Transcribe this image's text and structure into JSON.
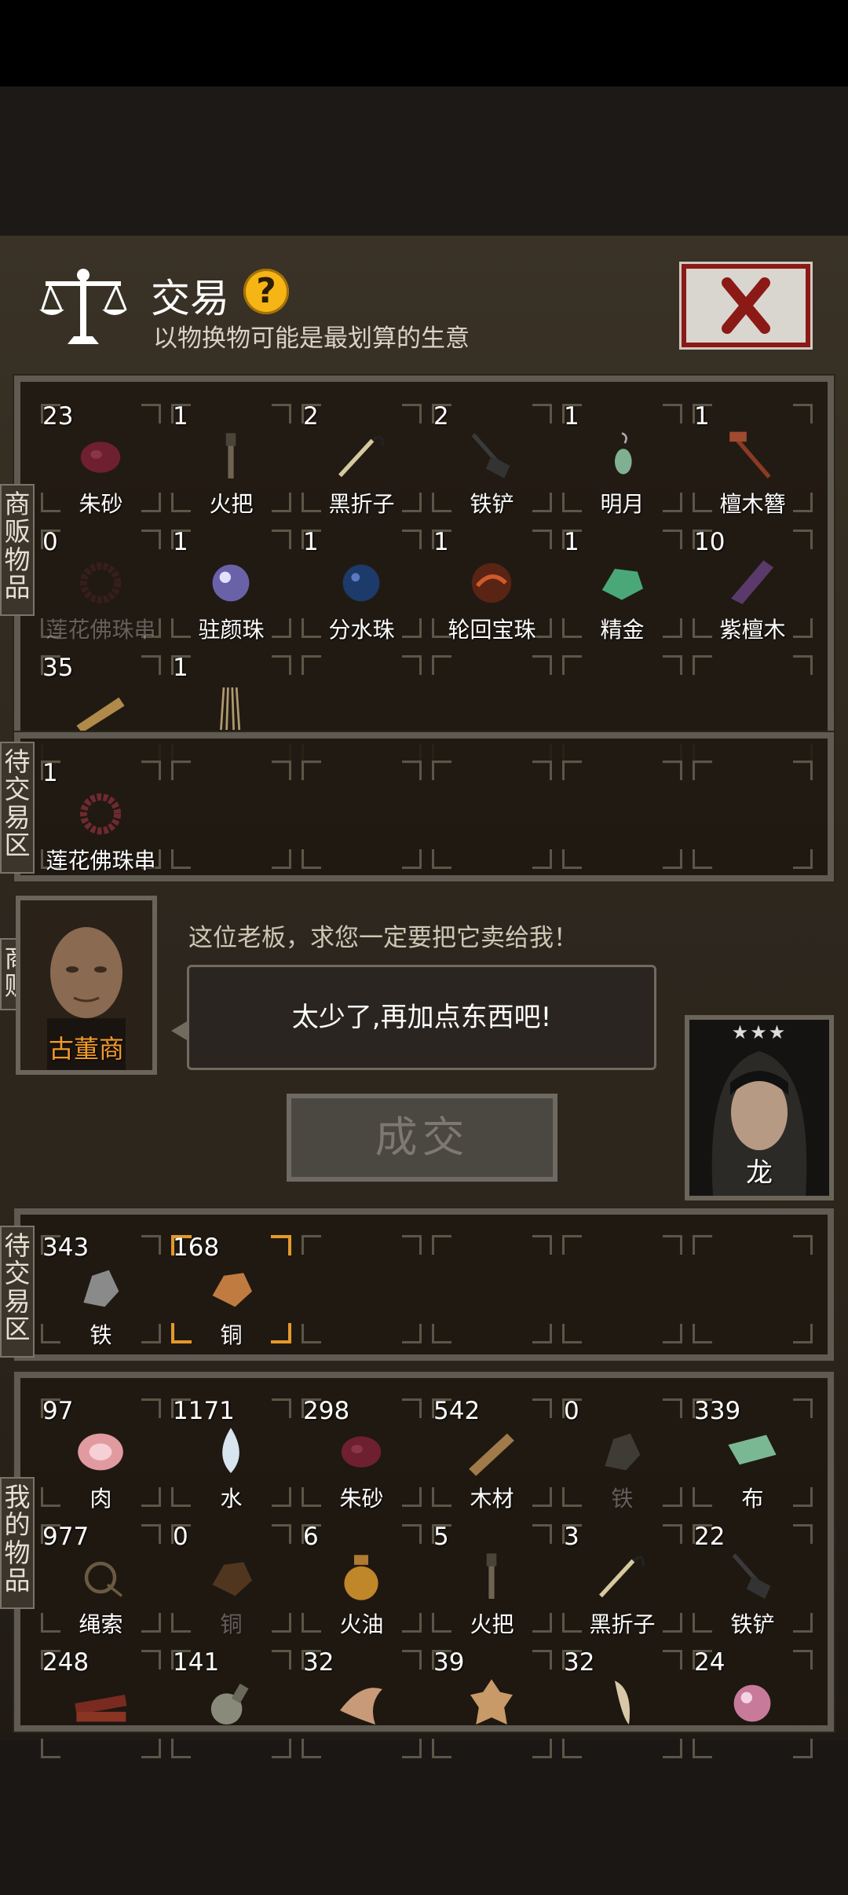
{
  "header": {
    "title": "交易",
    "help_icon": "?",
    "subtitle": "以物换物可能是最划算的生意"
  },
  "labels": {
    "merchant_goods": "商\n贩\n物\n品",
    "pending_top": "待\n交\n易\n区",
    "merchant": "商\n贩",
    "pending_bottom": "待\n交\n易\n区",
    "my_goods": "我\n的\n物\n品"
  },
  "merchant_goods": [
    {
      "count": "23",
      "name": "朱砂",
      "icon": "cinnabar-icon"
    },
    {
      "count": "1",
      "name": "火把",
      "icon": "torch-icon"
    },
    {
      "count": "2",
      "name": "黑折子",
      "icon": "black-hook-icon"
    },
    {
      "count": "2",
      "name": "铁铲",
      "icon": "shovel-icon"
    },
    {
      "count": "1",
      "name": "明月",
      "icon": "moon-earring-icon"
    },
    {
      "count": "1",
      "name": "檀木簪",
      "icon": "hairpin-icon"
    },
    {
      "count": "0",
      "name": "莲花佛珠串",
      "icon": "prayer-beads-icon"
    },
    {
      "count": "1",
      "name": "驻颜珠",
      "icon": "pearl-icon"
    },
    {
      "count": "1",
      "name": "分水珠",
      "icon": "water-pearl-icon"
    },
    {
      "count": "1",
      "name": "轮回宝珠",
      "icon": "reincarnation-pearl-icon"
    },
    {
      "count": "1",
      "name": "精金",
      "icon": "gold-ore-icon"
    },
    {
      "count": "10",
      "name": "紫檀木",
      "icon": "rosewood-icon"
    },
    {
      "count": "35",
      "name": "",
      "icon": "wood-plank-icon"
    },
    {
      "count": "1",
      "name": "",
      "icon": "rope-bundle-icon"
    }
  ],
  "merchant_pending": [
    {
      "count": "1",
      "name": "莲花佛珠串",
      "icon": "prayer-beads-icon"
    }
  ],
  "merchant": {
    "name": "古董商",
    "plea": "这位老板，求您一定要把它卖给我！",
    "speech": "太少了,再加点东西吧!"
  },
  "deal_button": "成交",
  "player": {
    "stars": "★★★",
    "name": "龙"
  },
  "my_pending": [
    {
      "count": "343",
      "name": "铁",
      "icon": "iron-ore-icon"
    },
    {
      "count": "168",
      "name": "铜",
      "icon": "copper-ore-icon"
    }
  ],
  "my_goods": [
    {
      "count": "97",
      "name": "肉",
      "icon": "meat-icon"
    },
    {
      "count": "1171",
      "name": "水",
      "icon": "water-drop-icon"
    },
    {
      "count": "298",
      "name": "朱砂",
      "icon": "cinnabar-icon"
    },
    {
      "count": "542",
      "name": "木材",
      "icon": "timber-icon"
    },
    {
      "count": "0",
      "name": "铁",
      "icon": "iron-ore-icon"
    },
    {
      "count": "339",
      "name": "布",
      "icon": "cloth-icon"
    },
    {
      "count": "977",
      "name": "绳索",
      "icon": "rope-icon"
    },
    {
      "count": "0",
      "name": "铜",
      "icon": "copper-ore-icon"
    },
    {
      "count": "6",
      "name": "火油",
      "icon": "oil-bottle-icon"
    },
    {
      "count": "5",
      "name": "火把",
      "icon": "torch-icon"
    },
    {
      "count": "3",
      "name": "黑折子",
      "icon": "black-hook-icon"
    },
    {
      "count": "22",
      "name": "铁铲",
      "icon": "shovel-icon"
    },
    {
      "count": "248",
      "name": "",
      "icon": "dried-meat-icon"
    },
    {
      "count": "141",
      "name": "",
      "icon": "gourd-bottle-icon"
    },
    {
      "count": "32",
      "name": "",
      "icon": "claw-icon"
    },
    {
      "count": "39",
      "name": "",
      "icon": "tiger-pelt-icon"
    },
    {
      "count": "32",
      "name": "",
      "icon": "fang-icon"
    },
    {
      "count": "24",
      "name": "",
      "icon": "pink-pearl-icon"
    }
  ],
  "colors": {
    "accent_orange": "#f29b2a",
    "close_red": "#8b1a16",
    "help_yellow": "#f5b515"
  }
}
